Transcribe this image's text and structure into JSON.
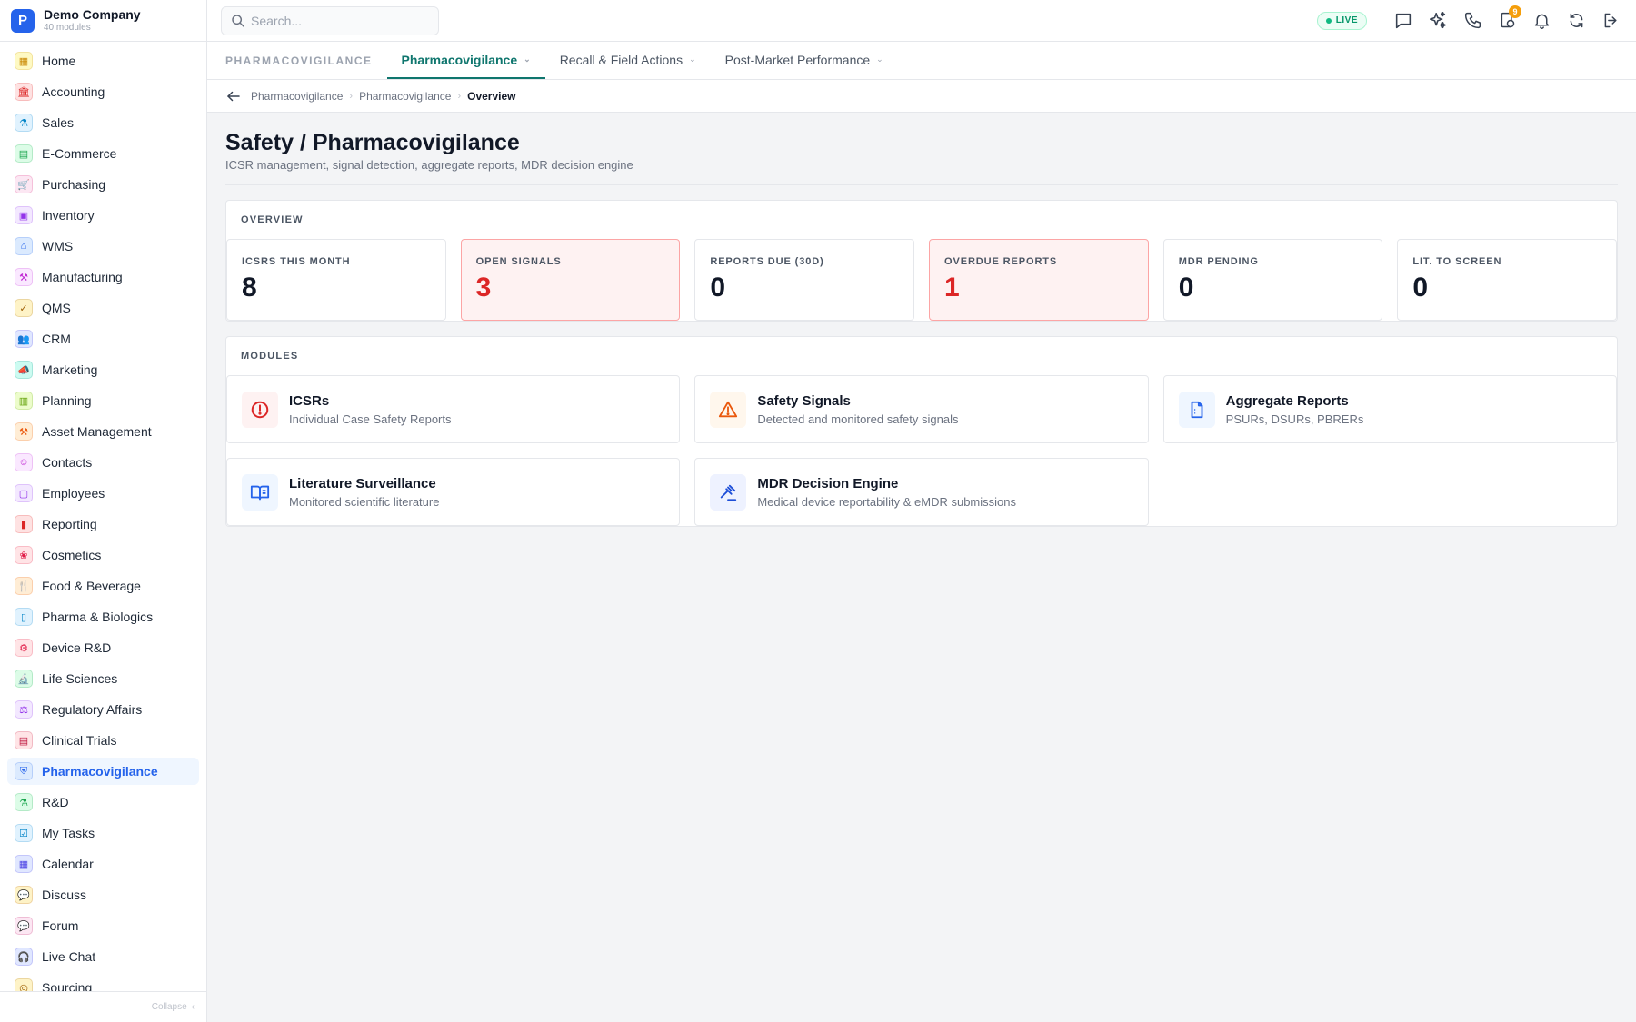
{
  "brand": {
    "logo_letter": "P",
    "name": "Demo Company",
    "subtitle": "40 modules"
  },
  "sidebar": {
    "items": [
      {
        "label": "Home",
        "icon": "grid-icon",
        "color": "#ca8a04",
        "bg": "#fef9c3",
        "glyph": "▦"
      },
      {
        "label": "Accounting",
        "icon": "bank-icon",
        "color": "#dc2626",
        "bg": "#fee2e2",
        "glyph": "🏛"
      },
      {
        "label": "Sales",
        "icon": "flask-icon",
        "color": "#0284c7",
        "bg": "#e0f2fe",
        "glyph": "⚗"
      },
      {
        "label": "E-Commerce",
        "icon": "store-icon",
        "color": "#16a34a",
        "bg": "#dcfce7",
        "glyph": "▤"
      },
      {
        "label": "Purchasing",
        "icon": "cart-icon",
        "color": "#db2777",
        "bg": "#fce7f3",
        "glyph": "🛒"
      },
      {
        "label": "Inventory",
        "icon": "box-icon",
        "color": "#9333ea",
        "bg": "#f3e8ff",
        "glyph": "▣"
      },
      {
        "label": "WMS",
        "icon": "warehouse-icon",
        "color": "#2563eb",
        "bg": "#dbeafe",
        "glyph": "⌂"
      },
      {
        "label": "Manufacturing",
        "icon": "factory-icon",
        "color": "#c026d3",
        "bg": "#fae8ff",
        "glyph": "⚒"
      },
      {
        "label": "QMS",
        "icon": "badge-check-icon",
        "color": "#a16207",
        "bg": "#fef3c7",
        "glyph": "✓"
      },
      {
        "label": "CRM",
        "icon": "users-icon",
        "color": "#4f46e5",
        "bg": "#e0e7ff",
        "glyph": "👥"
      },
      {
        "label": "Marketing",
        "icon": "megaphone-icon",
        "color": "#0d9488",
        "bg": "#ccfbf1",
        "glyph": "📣"
      },
      {
        "label": "Planning",
        "icon": "clipboard-icon",
        "color": "#65a30d",
        "bg": "#ecfccb",
        "glyph": "▥"
      },
      {
        "label": "Asset Management",
        "icon": "tools-icon",
        "color": "#ea580c",
        "bg": "#ffedd5",
        "glyph": "⚒"
      },
      {
        "label": "Contacts",
        "icon": "contact-icon",
        "color": "#c026d3",
        "bg": "#fae8ff",
        "glyph": "☺"
      },
      {
        "label": "Employees",
        "icon": "briefcase-icon",
        "color": "#9333ea",
        "bg": "#f3e8ff",
        "glyph": "▢"
      },
      {
        "label": "Reporting",
        "icon": "bar-chart-icon",
        "color": "#dc2626",
        "bg": "#fee2e2",
        "glyph": "▮"
      },
      {
        "label": "Cosmetics",
        "icon": "lotus-icon",
        "color": "#e11d48",
        "bg": "#ffe4e6",
        "glyph": "❀"
      },
      {
        "label": "Food & Beverage",
        "icon": "utensils-icon",
        "color": "#ea580c",
        "bg": "#ffedd5",
        "glyph": "🍴"
      },
      {
        "label": "Pharma & Biologics",
        "icon": "pill-bottle-icon",
        "color": "#0284c7",
        "bg": "#e0f2fe",
        "glyph": "▯"
      },
      {
        "label": "Device R&D",
        "icon": "cog-icon",
        "color": "#e11d48",
        "bg": "#ffe4e6",
        "glyph": "⚙"
      },
      {
        "label": "Life Sciences",
        "icon": "microscope-icon",
        "color": "#16a34a",
        "bg": "#dcfce7",
        "glyph": "🔬"
      },
      {
        "label": "Regulatory Affairs",
        "icon": "gavel-icon",
        "color": "#9333ea",
        "bg": "#f3e8ff",
        "glyph": "⚖"
      },
      {
        "label": "Clinical Trials",
        "icon": "clipboard-list-icon",
        "color": "#be123c",
        "bg": "#ffe4e6",
        "glyph": "▤"
      },
      {
        "label": "Pharmacovigilance",
        "icon": "shield-icon",
        "color": "#2563eb",
        "bg": "#dbeafe",
        "glyph": "⛨",
        "active": true
      },
      {
        "label": "R&D",
        "icon": "beaker-icon",
        "color": "#16a34a",
        "bg": "#dcfce7",
        "glyph": "⚗"
      },
      {
        "label": "My Tasks",
        "icon": "checklist-icon",
        "color": "#0284c7",
        "bg": "#e0f2fe",
        "glyph": "☑"
      },
      {
        "label": "Calendar",
        "icon": "calendar-icon",
        "color": "#4f46e5",
        "bg": "#e0e7ff",
        "glyph": "▦"
      },
      {
        "label": "Discuss",
        "icon": "chat-icon",
        "color": "#b45309",
        "bg": "#fef3c7",
        "glyph": "💬"
      },
      {
        "label": "Forum",
        "icon": "forum-icon",
        "color": "#be185d",
        "bg": "#fce7f3",
        "glyph": "💬"
      },
      {
        "label": "Live Chat",
        "icon": "headset-icon",
        "color": "#4f46e5",
        "bg": "#e0e7ff",
        "glyph": "🎧"
      },
      {
        "label": "Sourcing",
        "icon": "globe-icon",
        "color": "#a16207",
        "bg": "#fef3c7",
        "glyph": "◎"
      }
    ],
    "collapse_label": "Collapse"
  },
  "search": {
    "placeholder": "Search..."
  },
  "topbar": {
    "live_label": "LIVE",
    "notification_badge": "9"
  },
  "tabs": {
    "section_label": "PHARMACOVIGILANCE",
    "items": [
      {
        "label": "Pharmacovigilance"
      },
      {
        "label": "Recall & Field Actions"
      },
      {
        "label": "Post-Market Performance"
      }
    ]
  },
  "breadcrumb": [
    "Pharmacovigilance",
    "Pharmacovigilance",
    "Overview"
  ],
  "page": {
    "title": "Safety / Pharmacovigilance",
    "subtitle": "ICSR management, signal detection, aggregate reports, MDR decision engine"
  },
  "overview": {
    "title": "OVERVIEW",
    "stats": [
      {
        "label": "ICSRS THIS MONTH",
        "value": "8",
        "alert": false
      },
      {
        "label": "OPEN SIGNALS",
        "value": "3",
        "alert": true
      },
      {
        "label": "REPORTS DUE (30D)",
        "value": "0",
        "alert": false
      },
      {
        "label": "OVERDUE REPORTS",
        "value": "1",
        "alert": true
      },
      {
        "label": "MDR PENDING",
        "value": "0",
        "alert": false
      },
      {
        "label": "LIT. TO SCREEN",
        "value": "0",
        "alert": false
      }
    ]
  },
  "modules": {
    "title": "MODULES",
    "items": [
      {
        "title": "ICSRs",
        "desc": "Individual Case Safety Reports",
        "icon": "alert-circle-icon",
        "color": "#dc2626",
        "bg": "#fef2f2"
      },
      {
        "title": "Safety Signals",
        "desc": "Detected and monitored safety signals",
        "icon": "warning-triangle-icon",
        "color": "#ea580c",
        "bg": "#fff7ed"
      },
      {
        "title": "Aggregate Reports",
        "desc": "PSURs, DSURs, PBRERs",
        "icon": "document-icon",
        "color": "#2563eb",
        "bg": "#eff6ff"
      },
      {
        "title": "Literature Surveillance",
        "desc": "Monitored scientific literature",
        "icon": "book-open-icon",
        "color": "#2563eb",
        "bg": "#eff6ff"
      },
      {
        "title": "MDR Decision Engine",
        "desc": "Medical device reportability & eMDR submissions",
        "icon": "gavel-icon",
        "color": "#1d4ed8",
        "bg": "#eef2ff"
      }
    ]
  }
}
